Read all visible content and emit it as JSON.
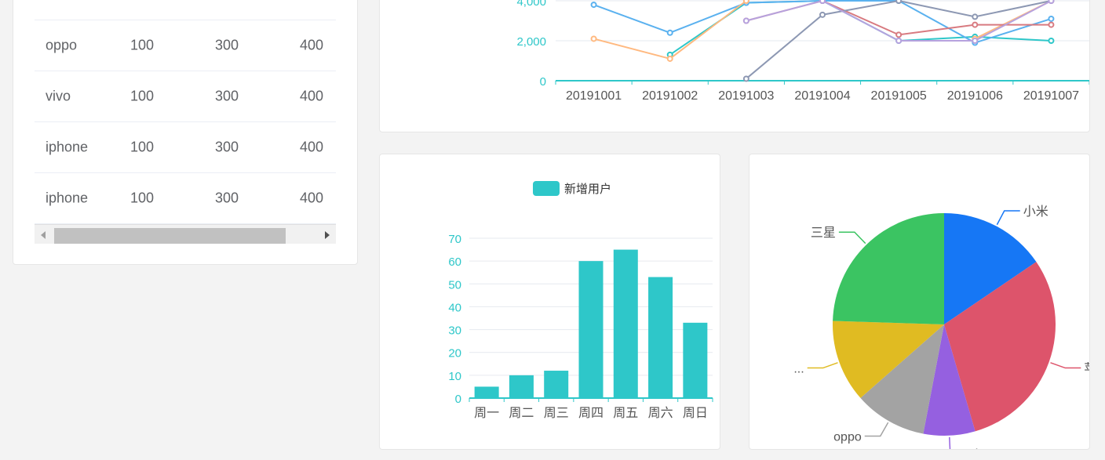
{
  "table": {
    "rows": [
      [
        "oppo",
        "100",
        "300",
        "400"
      ],
      [
        "vivo",
        "100",
        "300",
        "400"
      ],
      [
        "iphone",
        "100",
        "300",
        "400"
      ],
      [
        "iphone",
        "100",
        "300",
        "400"
      ]
    ]
  },
  "colors": {
    "teal": "#2ec7c9",
    "blue": "#5ab1ef",
    "orange": "#ffb980",
    "red": "#d87a80",
    "gray": "#8d98b3",
    "purple": "#b6a2de",
    "pie": [
      "#1677f5",
      "#dd546b",
      "#9560e0",
      "#a3a3a3",
      "#e0bb22",
      "#3bc462"
    ]
  },
  "chart_data": [
    {
      "type": "line",
      "x": [
        "20191001",
        "20191002",
        "20191003",
        "20191004",
        "20191005",
        "20191006",
        "20191007"
      ],
      "y_ticks": [
        "0",
        "2,000",
        "4,000"
      ],
      "ylim": [
        0,
        4000
      ],
      "series": [
        {
          "values": [
            null,
            1300,
            3900,
            4000,
            2000,
            2200,
            2000
          ],
          "color": "#2ec7c9"
        },
        {
          "values": [
            3800,
            2400,
            3900,
            4000,
            4000,
            1900,
            3100
          ],
          "color": "#5ab1ef"
        },
        {
          "values": [
            2100,
            1100,
            4000,
            null,
            null,
            2100,
            4000
          ],
          "color": "#ffb980"
        },
        {
          "values": [
            null,
            null,
            3000,
            4000,
            2300,
            2800,
            2800
          ],
          "color": "#d87a80"
        },
        {
          "values": [
            null,
            null,
            100,
            3300,
            4000,
            3200,
            4000
          ],
          "color": "#8d98b3"
        },
        {
          "values": [
            null,
            null,
            3000,
            4000,
            2000,
            2000,
            4000
          ],
          "color": "#b6a2de"
        }
      ]
    },
    {
      "type": "bar",
      "legend": "新增用户",
      "categories": [
        "周一",
        "周二",
        "周三",
        "周四",
        "周五",
        "周六",
        "周日"
      ],
      "values": [
        5,
        10,
        12,
        60,
        65,
        53,
        33
      ],
      "y_ticks": [
        "0",
        "10",
        "20",
        "30",
        "40",
        "50",
        "60",
        "70"
      ],
      "ylim": [
        0,
        70
      ],
      "color": "#2ec7c9"
    },
    {
      "type": "pie",
      "labels": [
        "小米",
        "苹",
        "vivo",
        "oppo",
        "...",
        "三星"
      ],
      "values": [
        15.5,
        30,
        7.5,
        10.5,
        12,
        24.5
      ]
    }
  ]
}
